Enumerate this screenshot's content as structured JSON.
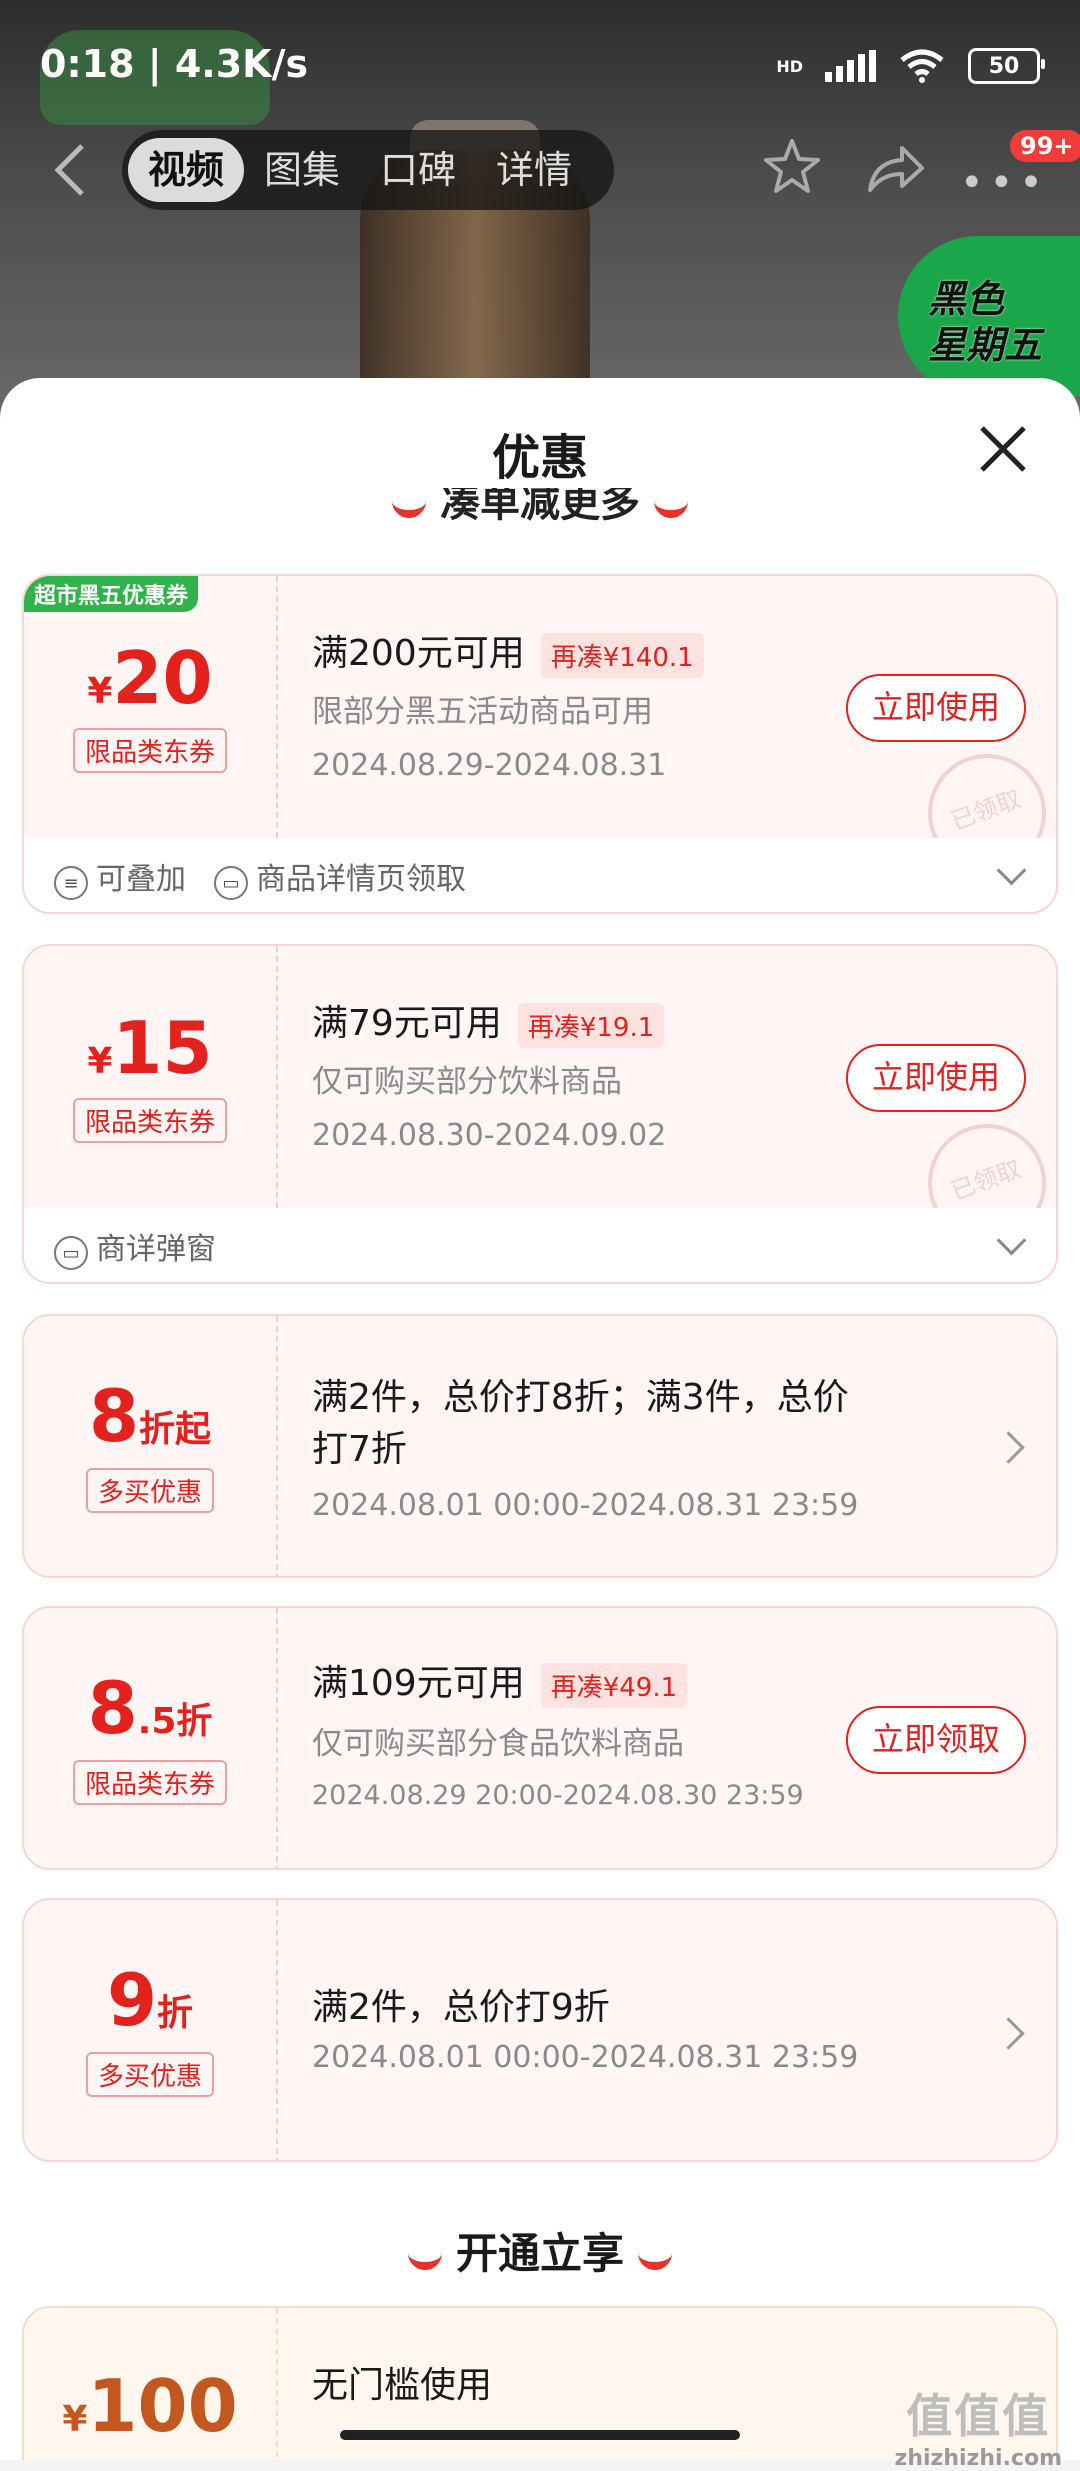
{
  "status": {
    "time": "0:18 | 4.3K/s",
    "network": "HD",
    "wifi_label": "6",
    "battery": "50"
  },
  "nav": {
    "tabs": [
      {
        "label": "视频",
        "active": true
      },
      {
        "label": "图集",
        "active": false
      },
      {
        "label": "口碑",
        "active": false
      },
      {
        "label": "详情",
        "active": false
      }
    ],
    "badge": "99+",
    "promo_badge_line1": "黑色",
    "promo_badge_line2": "星期五"
  },
  "sheet": {
    "title": "优惠",
    "top_section_heading": "凑单减更多",
    "coupons": [
      {
        "corner_tag": "超市黑五优惠券",
        "currency": "¥",
        "amount": "20",
        "unit": "",
        "tag": "限品类东券",
        "title": "满200元可用",
        "need": "再凑¥140.1",
        "desc": "限部分黑五活动商品可用",
        "date": "2024.08.29-2024.08.31",
        "button": "立即使用",
        "stamp": "已领取",
        "footer_items": [
          {
            "icon": "stack-icon",
            "text": "可叠加"
          },
          {
            "icon": "ticket-icon",
            "text": "商品详情页领取"
          }
        ]
      },
      {
        "currency": "¥",
        "amount": "15",
        "unit": "",
        "tag": "限品类东券",
        "title": "满79元可用",
        "need": "再凑¥19.1",
        "desc": "仅可购买部分饮料商品",
        "date": "2024.08.30-2024.09.02",
        "button": "立即使用",
        "stamp": "已领取",
        "footer_items": [
          {
            "icon": "ticket-icon",
            "text": "商详弹窗"
          }
        ]
      },
      {
        "amount": "8",
        "unit": "折起",
        "tag": "多买优惠",
        "title_line1": "满2件，总价打8折；满3件，总价",
        "title_line2": "打7折",
        "date": "2024.08.01 00:00-2024.08.31 23:59"
      },
      {
        "amount": "8",
        "amount_decimal": ".5",
        "unit": "折",
        "tag": "限品类东券",
        "title": "满109元可用",
        "need": "再凑¥49.1",
        "desc": "仅可购买部分食品饮料商品",
        "date": "2024.08.29 20:00-2024.08.30 23:59",
        "button": "立即领取"
      },
      {
        "amount": "9",
        "unit": "折",
        "tag": "多买优惠",
        "title": "满2件，总价打9折",
        "date": "2024.08.01 00:00-2024.08.31 23:59"
      }
    ],
    "member_section_heading": "开通立享",
    "member_coupon": {
      "currency": "¥",
      "amount": "100",
      "title": "无门槛使用"
    }
  },
  "watermark": {
    "big": "值值值",
    "small": "zhizhizhi.com"
  }
}
